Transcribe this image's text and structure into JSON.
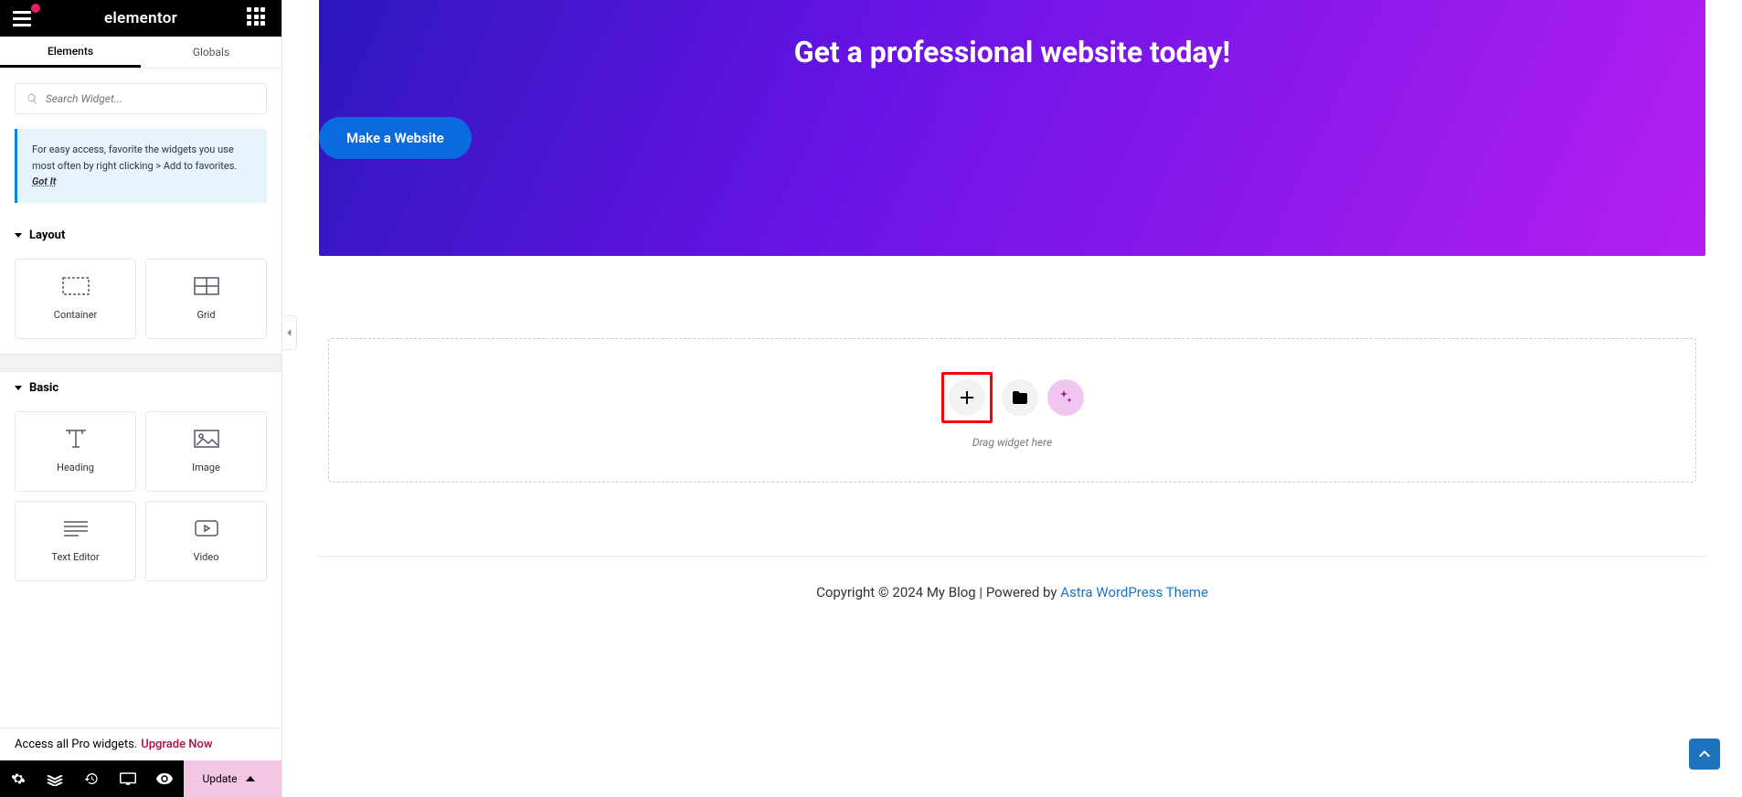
{
  "header": {
    "brand": "elementor"
  },
  "tabs": {
    "elements": "Elements",
    "globals": "Globals"
  },
  "search": {
    "placeholder": "Search Widget..."
  },
  "tip": {
    "text": "For easy access, favorite the widgets you use most often by right clicking > Add to favorites.",
    "dismiss": "Got It"
  },
  "sections": {
    "layout": {
      "title": "Layout",
      "widgets": {
        "container": "Container",
        "grid": "Grid"
      }
    },
    "basic": {
      "title": "Basic",
      "widgets": {
        "heading": "Heading",
        "image": "Image",
        "texteditor": "Text Editor",
        "video": "Video"
      }
    }
  },
  "upgrade": {
    "text": "Access all Pro widgets.",
    "link": "Upgrade Now"
  },
  "bottom": {
    "update": "Update"
  },
  "hero": {
    "title": "Get a professional website today!",
    "button": "Make a Website"
  },
  "dropzone": {
    "hint": "Drag widget here"
  },
  "footer": {
    "text": "Copyright © 2024 My Blog | Powered by ",
    "link": "Astra WordPress Theme"
  }
}
